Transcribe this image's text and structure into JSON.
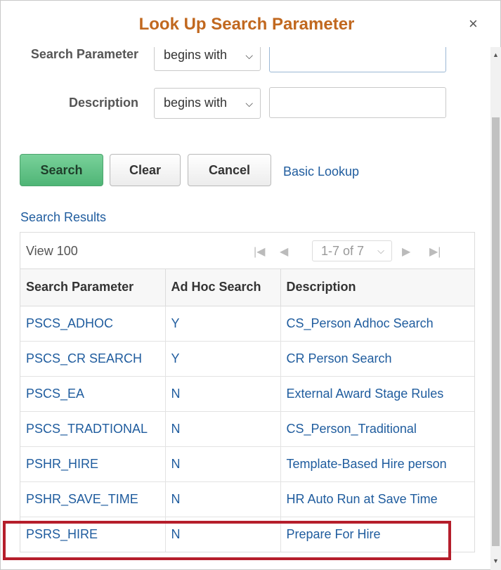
{
  "dialog": {
    "title": "Look Up Search Parameter",
    "close_glyph": "×"
  },
  "criteria": {
    "search_parameter_label": "Search Parameter",
    "search_parameter_operator": "begins with",
    "search_parameter_value": "",
    "description_label": "Description",
    "description_operator": "begins with",
    "description_value": ""
  },
  "buttons": {
    "search": "Search",
    "clear": "Clear",
    "cancel": "Cancel",
    "basic_lookup": "Basic Lookup"
  },
  "results": {
    "title": "Search Results",
    "view_all": "View 100",
    "pager": "1-7 of 7",
    "columns": [
      "Search Parameter",
      "Ad Hoc Search",
      "Description"
    ],
    "rows": [
      [
        "PSCS_ADHOC",
        "Y",
        "CS_Person Adhoc Search"
      ],
      [
        "PSCS_CR SEARCH",
        "Y",
        "CR Person Search"
      ],
      [
        "PSCS_EA",
        "N",
        "External Award Stage Rules"
      ],
      [
        "PSCS_TRADTIONAL",
        "N",
        "CS_Person_Traditional"
      ],
      [
        "PSHR_HIRE",
        "N",
        "Template-Based Hire person"
      ],
      [
        "PSHR_SAVE_TIME",
        "N",
        "HR Auto Run at Save Time"
      ],
      [
        "PSRS_HIRE",
        "N",
        "Prepare For Hire"
      ]
    ]
  },
  "icons": {
    "first": "first-page-icon",
    "prev": "previous-page-icon",
    "next": "next-page-icon",
    "last": "last-page-icon",
    "dropdown": "chevron-down-icon"
  },
  "colors": {
    "title": "#c1681f",
    "link": "#1f5c9e",
    "primary_button": "#4fb576",
    "highlight": "#b51e2b"
  }
}
